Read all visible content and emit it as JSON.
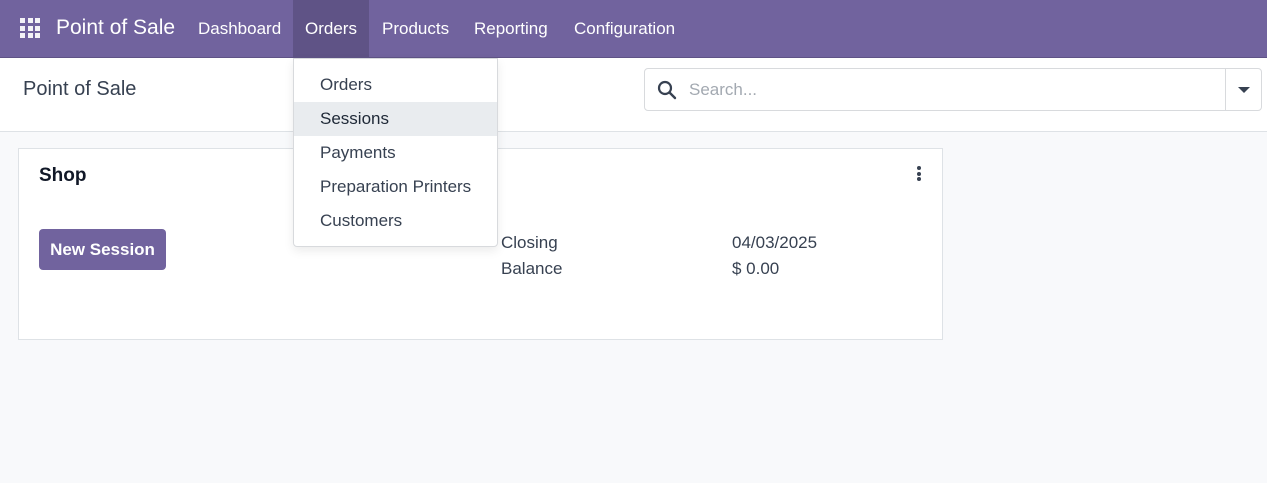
{
  "navbar": {
    "brand": "Point of Sale",
    "menu": [
      {
        "label": "Dashboard"
      },
      {
        "label": "Orders"
      },
      {
        "label": "Products"
      },
      {
        "label": "Reporting"
      },
      {
        "label": "Configuration"
      }
    ],
    "active_menu": "Orders"
  },
  "control_panel": {
    "breadcrumb": "Point of Sale",
    "search": {
      "placeholder": "Search..."
    }
  },
  "orders_dropdown": {
    "items": [
      {
        "label": "Orders"
      },
      {
        "label": "Sessions"
      },
      {
        "label": "Payments"
      },
      {
        "label": "Preparation Printers"
      },
      {
        "label": "Customers"
      }
    ],
    "highlighted": "Sessions"
  },
  "card": {
    "title": "Shop",
    "button_label": "New Session",
    "stats": [
      {
        "label": "Closing",
        "value": "04/03/2025"
      },
      {
        "label": "Balance",
        "value": "$ 0.00"
      }
    ]
  },
  "colors": {
    "brand": "#71639e",
    "brand_active": "#5f5386",
    "background": "#f8f9fb"
  }
}
